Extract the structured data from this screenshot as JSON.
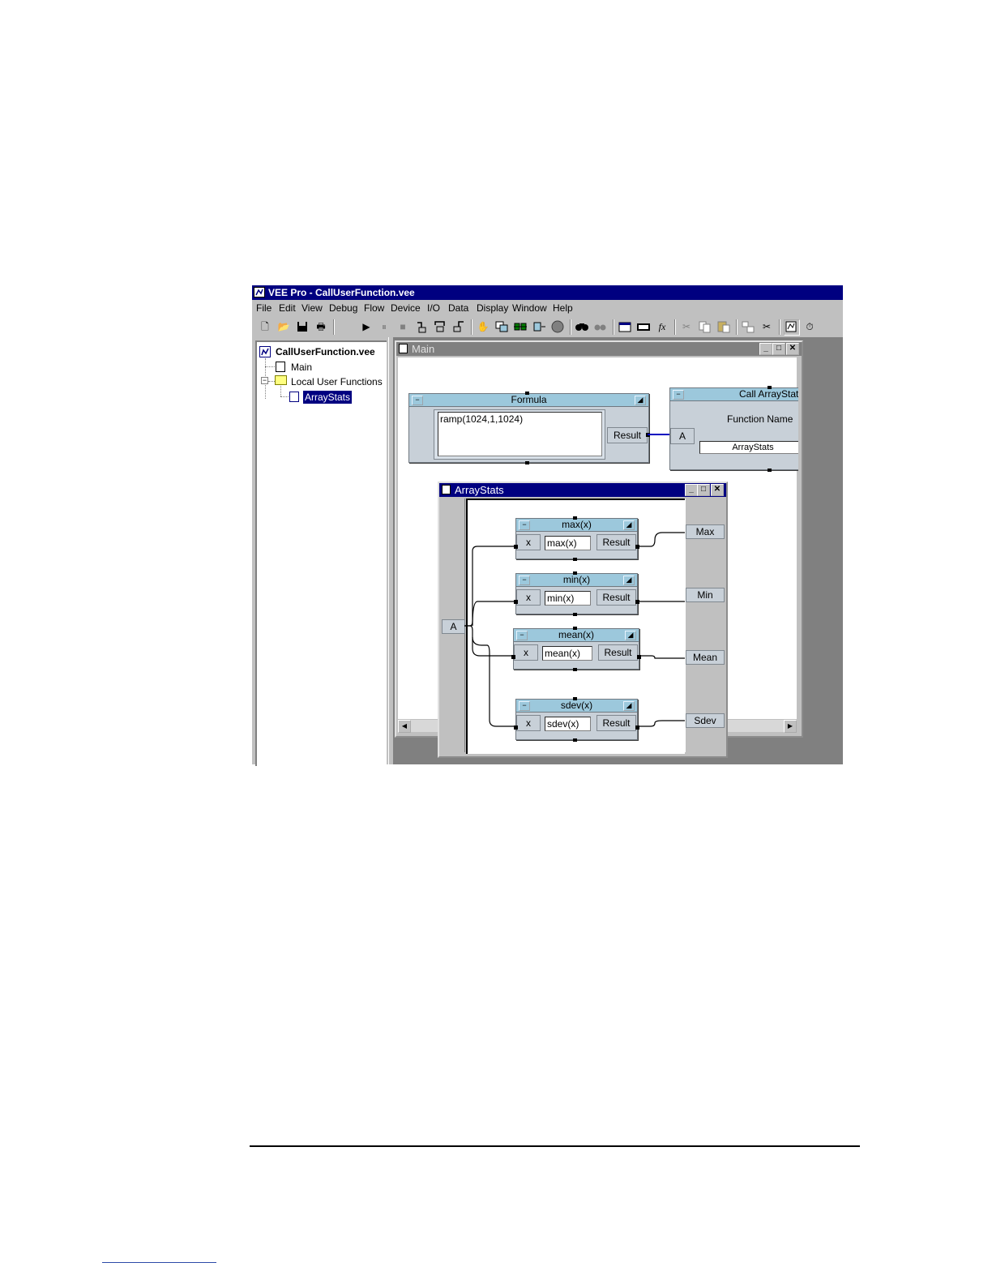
{
  "window": {
    "title": "VEE Pro - CallUserFunction.vee"
  },
  "menu": [
    "File",
    "Edit",
    "View",
    "Debug",
    "Flow",
    "Device",
    "I/O",
    "Data",
    "Display",
    "Window",
    "Help"
  ],
  "toolbar_icons": [
    "new-icon",
    "open-icon",
    "save-icon",
    "print-icon",
    "run-icon",
    "pause-icon",
    "stop-icon",
    "step-into-icon",
    "step-over-icon",
    "step-out-icon",
    "hand-icon",
    "clone-icon",
    "align-icon",
    "align-right-icon",
    "circle-icon",
    "find-icon",
    "find-next-icon",
    "properties-icon",
    "display-icon",
    "formula-icon",
    "cut-icon",
    "copy-icon",
    "paste-icon",
    "create-udf-icon",
    "delete-line-icon",
    "program-explorer-icon",
    "timer-icon"
  ],
  "explorer": {
    "root": "CallUserFunction.vee",
    "main": "Main",
    "folder": "Local User Functions",
    "function": "ArrayStats"
  },
  "main_window": {
    "title": "Main",
    "formula": {
      "title": "Formula",
      "expression": "ramp(1024,1,1024)",
      "output": "Result"
    },
    "call": {
      "title": "Call ArrayStats",
      "input": "A",
      "label": "Function Name",
      "value": "ArrayStats"
    }
  },
  "arraystats_window": {
    "title": "ArrayStats",
    "input": "A",
    "blocks": [
      {
        "title": "max(x)",
        "input": "x",
        "expr": "max(x)",
        "output": "Result",
        "terminal": "Max"
      },
      {
        "title": "min(x)",
        "input": "x",
        "expr": "min(x)",
        "output": "Result",
        "terminal": "Min"
      },
      {
        "title": "mean(x)",
        "input": "x",
        "expr": "mean(x)",
        "output": "Result",
        "terminal": "Mean"
      },
      {
        "title": "sdev(x)",
        "input": "x",
        "expr": "sdev(x)",
        "output": "Result",
        "terminal": "Sdev"
      }
    ]
  },
  "colors": {
    "titlebar": "#000080",
    "object_title": "#9cc8dc",
    "object_body": "#c8d0d8",
    "workspace": "#808080"
  }
}
